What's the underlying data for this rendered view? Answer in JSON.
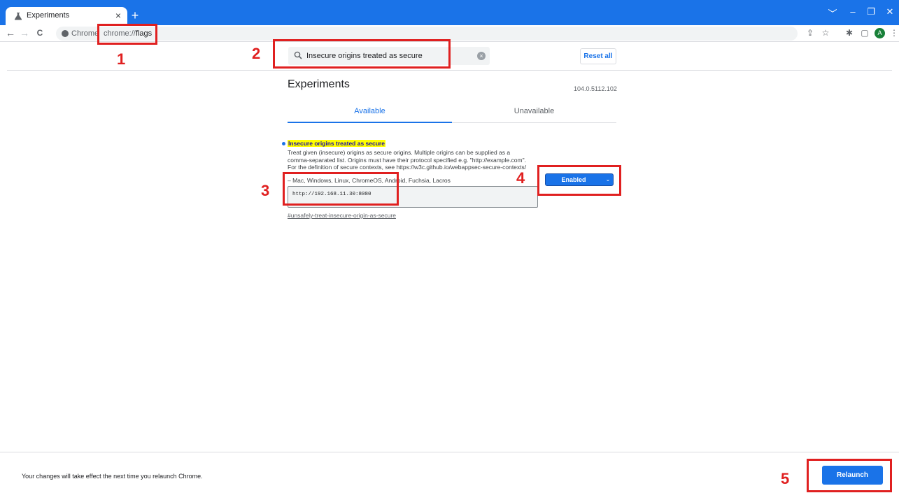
{
  "browser": {
    "tab_title": "Experiments",
    "tab_close": "×",
    "new_tab": "+",
    "window_controls": [
      "﹀",
      "–",
      "❐",
      "✕"
    ],
    "nav": {
      "back": "←",
      "forward": "→",
      "reload": "C"
    },
    "omnibox": {
      "chip_label": "Chrome",
      "url_scheme": "chrome://",
      "url_rest": "flags"
    },
    "toolbar_icons": [
      "share-icon",
      "star-icon",
      "puzzle-icon",
      "sidepanel-icon",
      "avatar",
      "menu-icon"
    ],
    "avatar_initial": "A",
    "menu_glyph": "⋮"
  },
  "header": {
    "search_value": "Insecure origins treated as secure",
    "clear_glyph": "×",
    "reset_label": "Reset all"
  },
  "main": {
    "title": "Experiments",
    "version": "104.0.5112.102",
    "tabs": [
      {
        "label": "Available",
        "active": true
      },
      {
        "label": "Unavailable",
        "active": false
      }
    ]
  },
  "flag": {
    "name": "Insecure origins treated as secure",
    "desc_lines": [
      "Treat given (insecure) origins as secure origins. Multiple origins can be supplied as a",
      "comma-separated list. Origins must have their protocol specified e.g. \"http://example.com\".",
      "For the definition of secure contexts, see https://w3c.github.io/webappsec-secure-contexts/"
    ],
    "platforms": "– Mac, Windows, Linux, ChromeOS, Android, Fuchsia, Lacros",
    "origin_value": "http://192.168.11.30:8080",
    "select_value": "Enabled",
    "chevron": "⌄",
    "link": "#unsafely-treat-insecure-origin-as-secure"
  },
  "footer": {
    "message": "Your changes will take effect the next time you relaunch Chrome.",
    "relaunch_label": "Relaunch"
  },
  "annotations": [
    "1",
    "2",
    "3",
    "4",
    "5"
  ],
  "colors": {
    "accent": "#1a73e8",
    "annotation": "#e02020",
    "highlight": "#ffff00"
  }
}
